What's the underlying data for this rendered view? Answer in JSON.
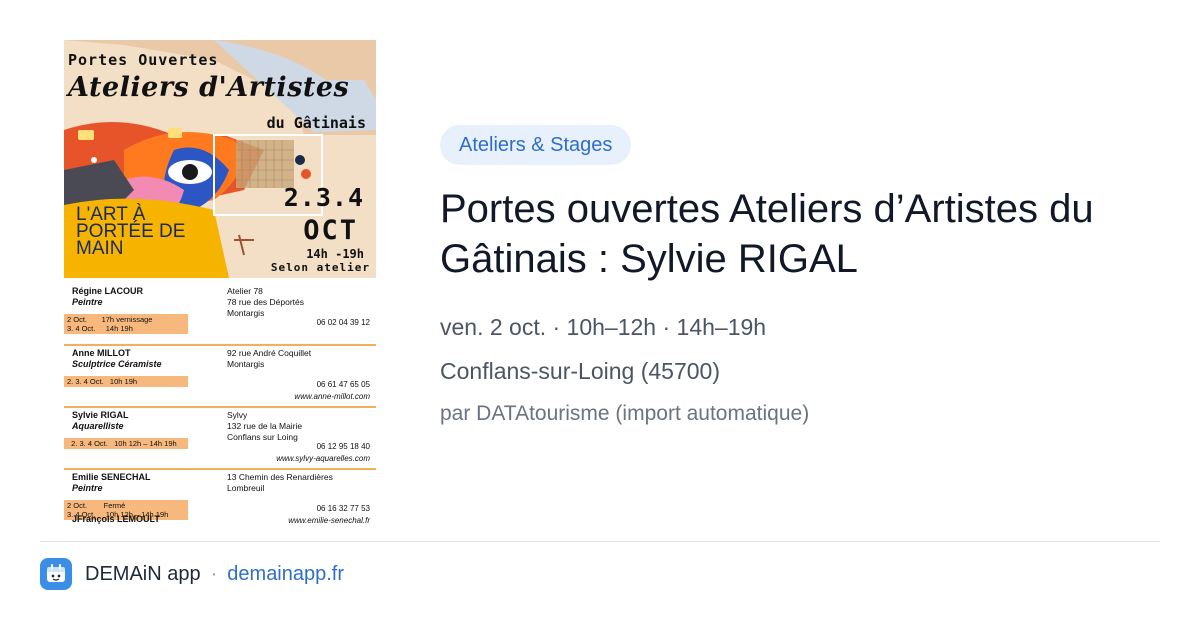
{
  "poster": {
    "portes": "Portes Ouvertes",
    "ateliers": "Ateliers d'Artistes",
    "gatinais": "du Gâtinais",
    "dates": "2.3.4",
    "month": "OCT",
    "hours": "14h -19h",
    "selon": "Selon atelier",
    "slogan": "L'ART À PORTÉE DE MAIN",
    "artists": [
      {
        "name": "Régine LACOUR",
        "role": "Peintre",
        "schedule": "2 Oct.       17h vernissage\n3. 4 Oct.     14h 19h",
        "place": "Atelier 78\n78 rue des Déportés\nMontargis",
        "phone": "06 02 04 39 12",
        "web": ""
      },
      {
        "name": "Anne MILLOT",
        "role": "Sculptrice Céramiste",
        "schedule": "2. 3. 4 Oct.   10h 19h",
        "place": "92 rue André Coquillet\nMontargis",
        "phone": "06 61 47 65 05",
        "web": "www.anne-millot.com"
      },
      {
        "name": "Sylvie RIGAL",
        "role": "Aquarelliste",
        "schedule": "  2. 3. 4 Oct.   10h 12h – 14h 19h",
        "place": "Sylvy\n132 rue de la Mairie\nConflans sur Loing",
        "phone": "06 12 95 18 40",
        "web": "www.sylvy-aquarelles.com"
      },
      {
        "name": "Emilie SENECHAL",
        "role": "Peintre",
        "schedule": "2 Oct.        Fermé\n3. 4 Oct.     10h 12h – 14h 19h",
        "place": "13 Chemin des Renardières\nLombreuil",
        "phone": "06 16 32 77 53",
        "web": "www.emilie-senechal.fr"
      }
    ],
    "last_artist": "JFrançois LEMOULT"
  },
  "category": "Ateliers & Stages",
  "title": "Portes ouvertes Ateliers d’Artistes du Gâtinais : Sylvie RIGAL",
  "when": "ven. 2 oct. · 10h–12h · 14h–19h",
  "where": "Conflans-sur-Loing (45700)",
  "by": "par DATAtourisme (import automatique)",
  "footer": {
    "app_name": "DEMAiN app",
    "separator": "·",
    "link": "demainapp.fr"
  },
  "colors": {
    "accent": "#2f6ec8",
    "badge_bg": "#e8f0fc",
    "app_icon": "#3a8ee6"
  }
}
